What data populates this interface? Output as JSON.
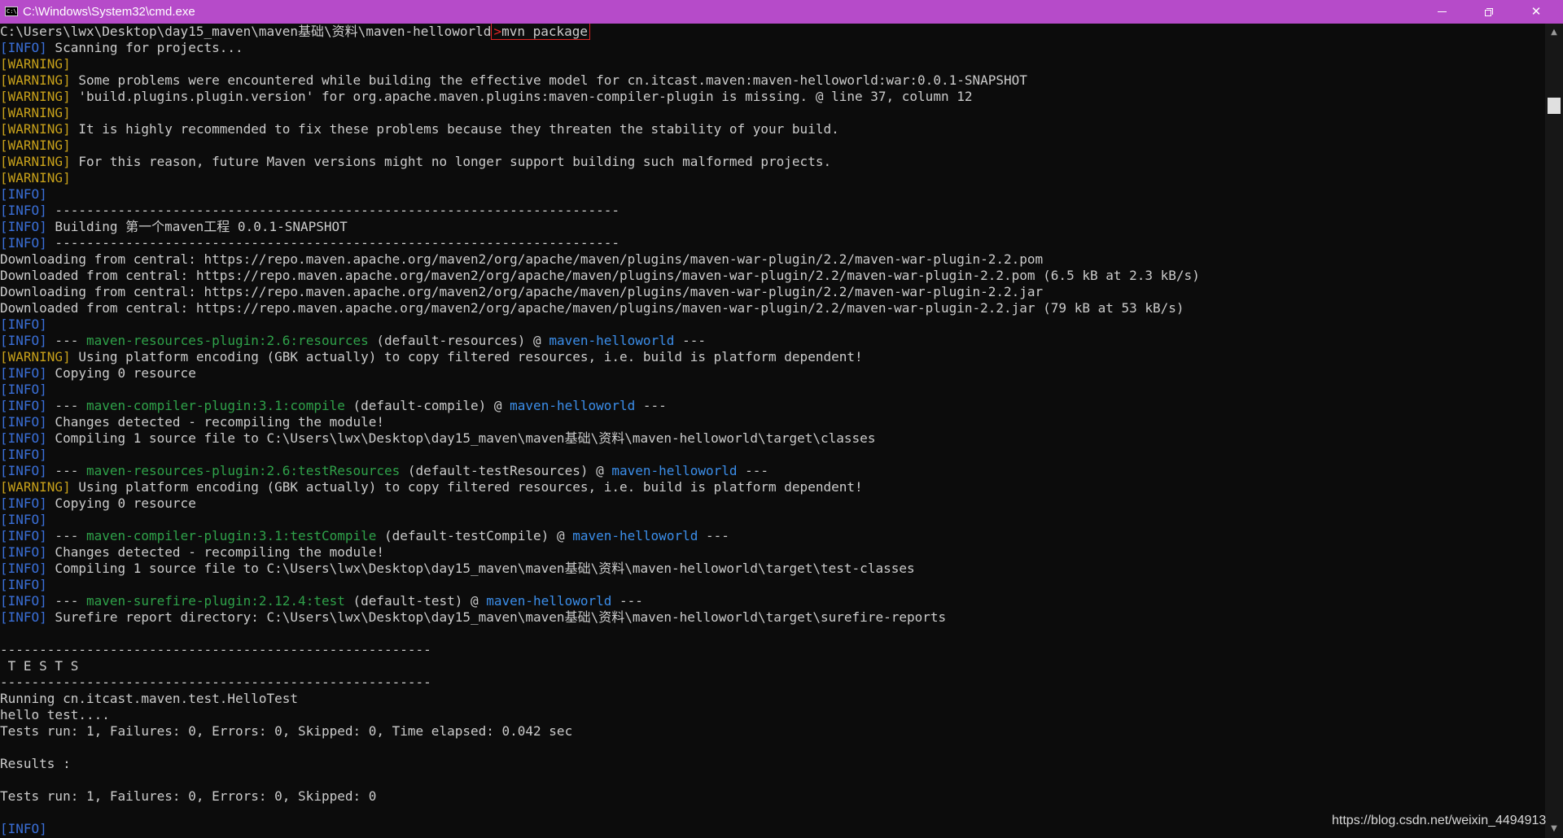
{
  "window": {
    "title": "C:\\Windows\\System32\\cmd.exe",
    "app_icon_label": "C:\\",
    "minimize_symbol": "—",
    "close_symbol": "✕"
  },
  "colors": {
    "titlebar": "#b64bc9",
    "background": "#0c0c0c",
    "text": "#cccccc",
    "info_tag": "#3a6fd8",
    "warning_tag": "#c8a11a",
    "plugin_green": "#2fa24a",
    "artifact_blue": "#3b8eea",
    "highlight_box": "#e02424"
  },
  "prompt": {
    "path": "C:\\Users\\lwx\\Desktop\\day15_maven\\maven基础\\资料\\maven-helloworld",
    "gt": ">",
    "command": "mvn package"
  },
  "tags": {
    "info": "[INFO]",
    "warning": "[WARNING]"
  },
  "lines": [
    {
      "tag": "info",
      "text": " Scanning for projects..."
    },
    {
      "tag": "warning",
      "text": ""
    },
    {
      "tag": "warning",
      "text": " Some problems were encountered while building the effective model for cn.itcast.maven:maven-helloworld:war:0.0.1-SNAPSHOT"
    },
    {
      "tag": "warning",
      "text": " 'build.plugins.plugin.version' for org.apache.maven.plugins:maven-compiler-plugin is missing. @ line 37, column 12"
    },
    {
      "tag": "warning",
      "text": ""
    },
    {
      "tag": "warning",
      "text": " It is highly recommended to fix these problems because they threaten the stability of your build."
    },
    {
      "tag": "warning",
      "text": ""
    },
    {
      "tag": "warning",
      "text": " For this reason, future Maven versions might no longer support building such malformed projects."
    },
    {
      "tag": "warning",
      "text": ""
    },
    {
      "tag": "info",
      "text": ""
    },
    {
      "tag": "info",
      "text": " ------------------------------------------------------------------------"
    },
    {
      "tag": "info",
      "text": " Building 第一个maven工程 0.0.1-SNAPSHOT"
    },
    {
      "tag": "info",
      "text": " ------------------------------------------------------------------------"
    },
    {
      "tag": "",
      "text": "Downloading from central: https://repo.maven.apache.org/maven2/org/apache/maven/plugins/maven-war-plugin/2.2/maven-war-plugin-2.2.pom"
    },
    {
      "tag": "",
      "text": "Downloaded from central: https://repo.maven.apache.org/maven2/org/apache/maven/plugins/maven-war-plugin/2.2/maven-war-plugin-2.2.pom (6.5 kB at 2.3 kB/s)"
    },
    {
      "tag": "",
      "text": "Downloading from central: https://repo.maven.apache.org/maven2/org/apache/maven/plugins/maven-war-plugin/2.2/maven-war-plugin-2.2.jar"
    },
    {
      "tag": "",
      "text": "Downloaded from central: https://repo.maven.apache.org/maven2/org/apache/maven/plugins/maven-war-plugin/2.2/maven-war-plugin-2.2.jar (79 kB at 53 kB/s)"
    },
    {
      "tag": "info",
      "text": ""
    },
    {
      "tag": "info",
      "pre": " --- ",
      "plugin": "maven-resources-plugin:2.6:resources",
      "mid": " (default-resources) @ ",
      "artifact": "maven-helloworld",
      "post": " ---"
    },
    {
      "tag": "warning",
      "text": " Using platform encoding (GBK actually) to copy filtered resources, i.e. build is platform dependent!"
    },
    {
      "tag": "info",
      "text": " Copying 0 resource"
    },
    {
      "tag": "info",
      "text": ""
    },
    {
      "tag": "info",
      "pre": " --- ",
      "plugin": "maven-compiler-plugin:3.1:compile",
      "mid": " (default-compile) @ ",
      "artifact": "maven-helloworld",
      "post": " ---"
    },
    {
      "tag": "info",
      "text": " Changes detected - recompiling the module!"
    },
    {
      "tag": "info",
      "text": " Compiling 1 source file to C:\\Users\\lwx\\Desktop\\day15_maven\\maven基础\\资料\\maven-helloworld\\target\\classes"
    },
    {
      "tag": "info",
      "text": ""
    },
    {
      "tag": "info",
      "pre": " --- ",
      "plugin": "maven-resources-plugin:2.6:testResources",
      "mid": " (default-testResources) @ ",
      "artifact": "maven-helloworld",
      "post": " ---"
    },
    {
      "tag": "warning",
      "text": " Using platform encoding (GBK actually) to copy filtered resources, i.e. build is platform dependent!"
    },
    {
      "tag": "info",
      "text": " Copying 0 resource"
    },
    {
      "tag": "info",
      "text": ""
    },
    {
      "tag": "info",
      "pre": " --- ",
      "plugin": "maven-compiler-plugin:3.1:testCompile",
      "mid": " (default-testCompile) @ ",
      "artifact": "maven-helloworld",
      "post": " ---"
    },
    {
      "tag": "info",
      "text": " Changes detected - recompiling the module!"
    },
    {
      "tag": "info",
      "text": " Compiling 1 source file to C:\\Users\\lwx\\Desktop\\day15_maven\\maven基础\\资料\\maven-helloworld\\target\\test-classes"
    },
    {
      "tag": "info",
      "text": ""
    },
    {
      "tag": "info",
      "pre": " --- ",
      "plugin": "maven-surefire-plugin:2.12.4:test",
      "mid": " (default-test) @ ",
      "artifact": "maven-helloworld",
      "post": " ---"
    },
    {
      "tag": "info",
      "text": " Surefire report directory: C:\\Users\\lwx\\Desktop\\day15_maven\\maven基础\\资料\\maven-helloworld\\target\\surefire-reports"
    },
    {
      "tag": "",
      "text": ""
    },
    {
      "tag": "",
      "text": "-------------------------------------------------------"
    },
    {
      "tag": "",
      "text": " T E S T S"
    },
    {
      "tag": "",
      "text": "-------------------------------------------------------"
    },
    {
      "tag": "",
      "text": "Running cn.itcast.maven.test.HelloTest"
    },
    {
      "tag": "",
      "text": "hello test...."
    },
    {
      "tag": "",
      "text": "Tests run: 1, Failures: 0, Errors: 0, Skipped: 0, Time elapsed: 0.042 sec"
    },
    {
      "tag": "",
      "text": ""
    },
    {
      "tag": "",
      "text": "Results :"
    },
    {
      "tag": "",
      "text": ""
    },
    {
      "tag": "",
      "text": "Tests run: 1, Failures: 0, Errors: 0, Skipped: 0"
    },
    {
      "tag": "",
      "text": ""
    },
    {
      "tag": "info",
      "text": ""
    }
  ],
  "scrollbar": {
    "up_arrow": "▲",
    "down_arrow": "▼"
  },
  "watermark": "https://blog.csdn.net/weixin_4494913"
}
